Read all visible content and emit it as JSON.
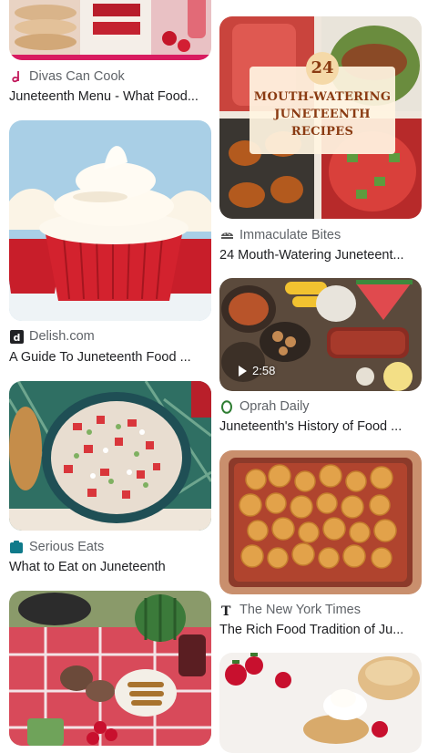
{
  "results": [
    {
      "source": "Divas Can Cook",
      "title": "Juneteenth Menu - What Food...",
      "icon": "divas-can-cook-logo",
      "icon_color": "#c2185b"
    },
    {
      "source": "Delish.com",
      "title": "A Guide To Juneteenth Food ...",
      "icon": "delish-logo",
      "icon_color": "#202124"
    },
    {
      "source": "Serious Eats",
      "title": "What to Eat on Juneteenth",
      "icon": "serious-eats-logo",
      "icon_color": "#0f7a8a"
    },
    {
      "source": "Immaculate Bites",
      "title": "24 Mouth-Watering Juneteent...",
      "icon": "immaculate-bites-logo",
      "icon_color": "#555555",
      "overlay_number": "24",
      "overlay_text": "MOUTH-WATERING JUNETEENTH RECIPES"
    },
    {
      "source": "Oprah Daily",
      "title": "Juneteenth's History of Food ...",
      "icon": "oprah-daily-logo",
      "icon_color": "#2e7d32",
      "video_duration": "2:58"
    },
    {
      "source": "The New York Times",
      "title": "The Rich Food Tradition of Ju...",
      "icon": "nyt-logo",
      "icon_color": "#202124"
    }
  ]
}
